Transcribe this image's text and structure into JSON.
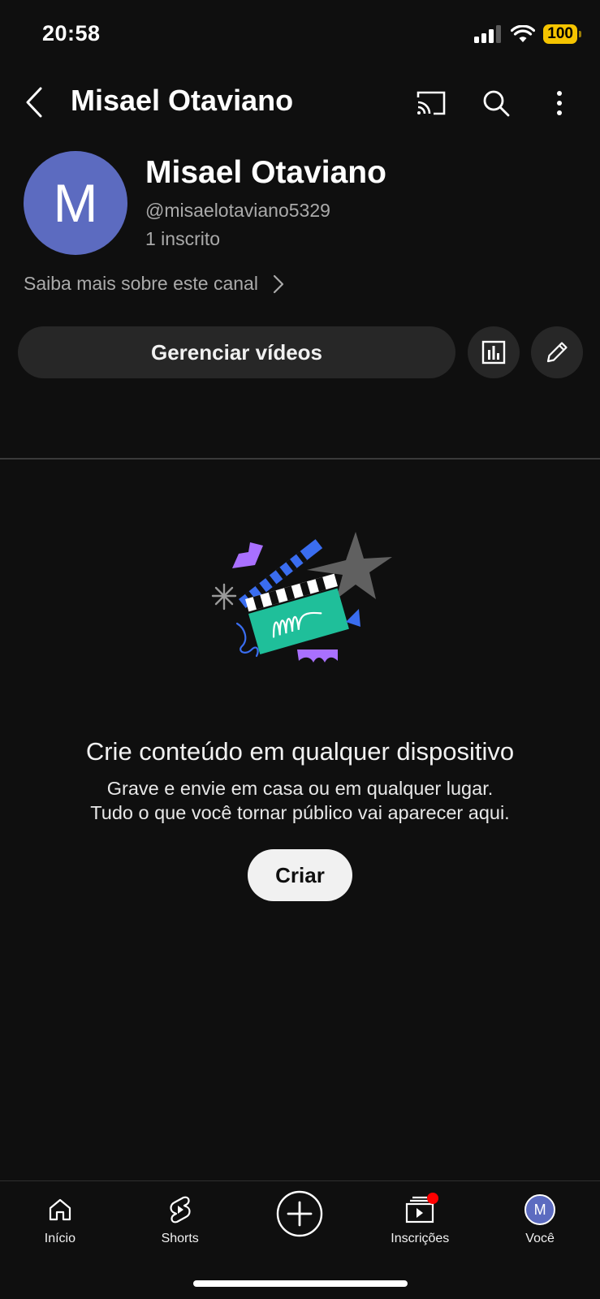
{
  "status_bar": {
    "time": "20:58",
    "battery": "100"
  },
  "header": {
    "title": "Misael Otaviano",
    "back_icon": "chevron-left-icon",
    "cast_icon": "cast-icon",
    "search_icon": "search-icon",
    "more_icon": "more-vert-icon"
  },
  "channel": {
    "avatar_letter": "M",
    "avatar_color": "#5c6bc0",
    "name": "Misael Otaviano",
    "handle": "@misaelotaviano5329",
    "subscribers": "1 inscrito",
    "about_link": "Saiba mais sobre este canal"
  },
  "actions": {
    "manage_videos": "Gerenciar vídeos",
    "analytics_icon": "analytics-icon",
    "edit_icon": "pencil-icon"
  },
  "empty_state": {
    "title": "Crie conteúdo em qualquer dispositivo",
    "line1": "Grave e envie em casa ou em qualquer lugar.",
    "line2": "Tudo o que você tornar público vai aparecer aqui.",
    "create_button": "Criar"
  },
  "bottom_nav": {
    "items": [
      {
        "label": "Início",
        "icon": "home-icon"
      },
      {
        "label": "Shorts",
        "icon": "shorts-icon"
      },
      {
        "label": "",
        "icon": "create-plus-icon"
      },
      {
        "label": "Inscrições",
        "icon": "subscriptions-icon",
        "badge_color": "#ff0000"
      },
      {
        "label": "Você",
        "icon": "avatar",
        "avatar_letter": "M"
      }
    ]
  }
}
